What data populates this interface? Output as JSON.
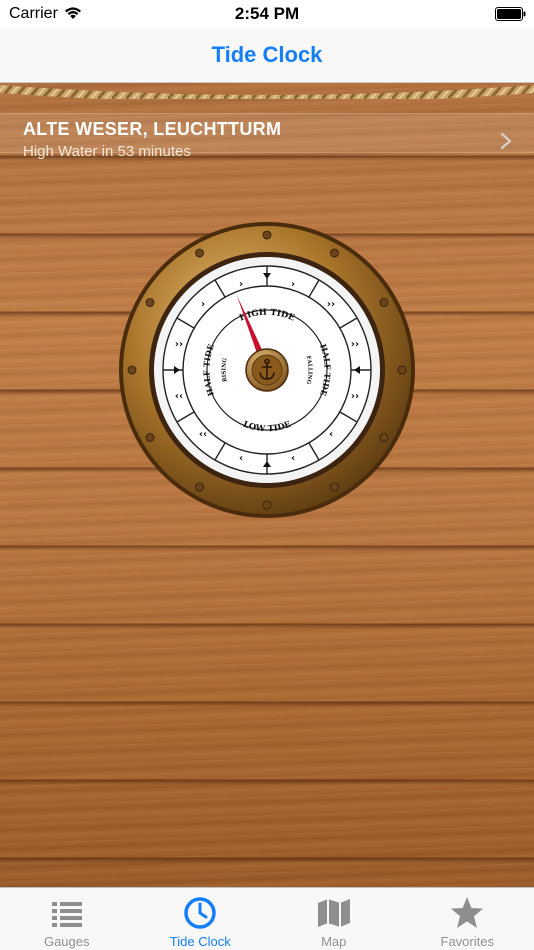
{
  "status_bar": {
    "carrier": "Carrier",
    "time": "2:54 PM"
  },
  "nav": {
    "title": "Tide Clock"
  },
  "station": {
    "name": "ALTE WESER, LEUCHTTURM",
    "subtitle": "High Water in 53 minutes"
  },
  "dial": {
    "high_label": "HIGH TIDE",
    "low_label": "LOW TIDE",
    "half_left": "HALF TIDE",
    "half_left_sub": "RISING",
    "half_right": "HALF TIDE",
    "half_right_sub": "FALLING",
    "hand_angle_deg": -22
  },
  "tabs": [
    {
      "label": "Gauges",
      "icon": "list-icon",
      "active": false
    },
    {
      "label": "Tide Clock",
      "icon": "clock-icon",
      "active": true
    },
    {
      "label": "Map",
      "icon": "map-icon",
      "active": false
    },
    {
      "label": "Favorites",
      "icon": "star-icon",
      "active": false
    }
  ],
  "colors": {
    "accent": "#157efb",
    "inactive": "#929292",
    "hand": "#c8102e",
    "brass": "#a8742a"
  }
}
